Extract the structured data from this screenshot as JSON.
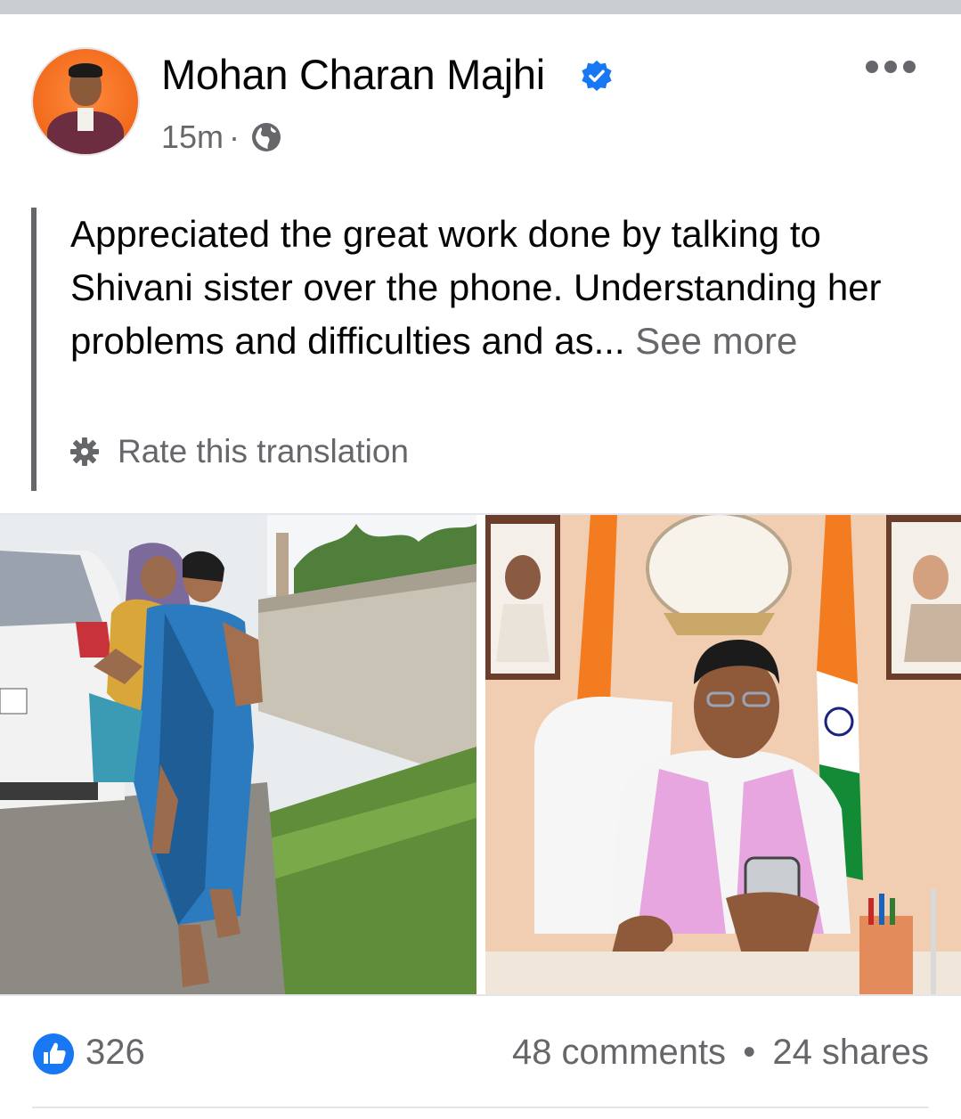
{
  "post": {
    "author": "Mohan Charan Majhi",
    "timestamp": "15m",
    "separator": "·",
    "privacy_icon": "globe-icon",
    "verified_icon": "verified-badge-icon",
    "more_icon": "more-options-icon",
    "text": "Appreciated the great work done by talking to Shivani sister over the phone. Understanding her problems and difficulties and as...",
    "see_more": "See more",
    "rate_translation": "Rate this translation",
    "rate_icon": "gear-icon"
  },
  "reactions": {
    "like_icon": "like-icon",
    "like_count": "326",
    "comments": "48 comments",
    "dot": "•",
    "shares": "24 shares"
  },
  "colors": {
    "accent_blue": "#1877f2",
    "secondary_text": "#65676b",
    "primary_text": "#050505"
  }
}
